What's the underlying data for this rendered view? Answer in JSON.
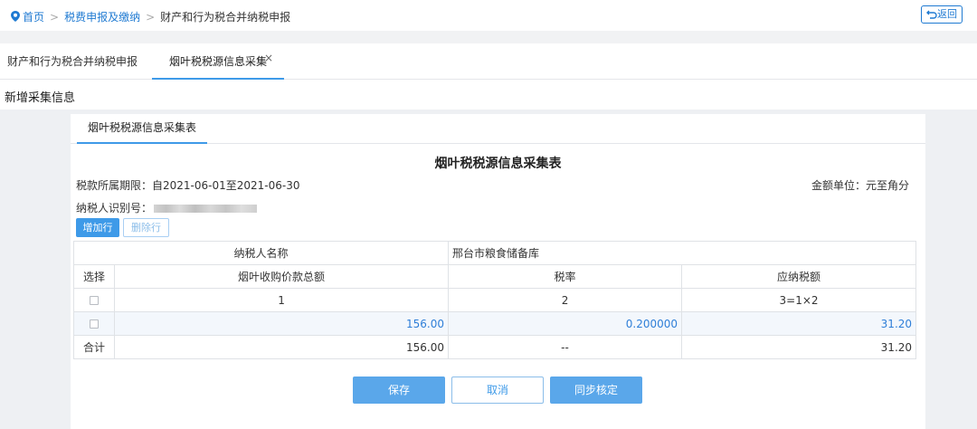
{
  "breadcrumb": {
    "home": "首页",
    "level1": "税费申报及缴纳",
    "current": "财产和行为税合并纳税申报",
    "separator": ">"
  },
  "back_label": "返回",
  "top_tabs": [
    {
      "label": "财产和行为税合并纳税申报"
    },
    {
      "label": "烟叶税税源信息采集",
      "close": "×"
    }
  ],
  "section_title": "新增采集信息",
  "card": {
    "tab_label": "烟叶税税源信息采集表",
    "form_title": "烟叶税税源信息采集表",
    "period": "税款所属期限：自2021-06-01至2021-06-30",
    "unit": "金额单位：元至角分",
    "taxid_label": "纳税人识别号："
  },
  "buttons": {
    "add_row": "增加行",
    "delete_row": "删除行",
    "save": "保存",
    "cancel": "取消",
    "sync": "同步核定"
  },
  "table": {
    "name_label": "纳税人名称",
    "name_value": "邢台市粮食储备库",
    "headers": [
      "选择",
      "烟叶收购价款总额",
      "税率",
      "应纳税额"
    ],
    "index_row": [
      "1",
      "2",
      "3=1×2"
    ],
    "data_row": [
      "156.00",
      "0.200000",
      "31.20"
    ],
    "total_row": [
      "合计",
      "156.00",
      "--",
      "31.20"
    ]
  },
  "colors": {
    "accent": "#3e9ae8",
    "link": "#1f7ad2",
    "value_blue": "#2f7fd8"
  }
}
